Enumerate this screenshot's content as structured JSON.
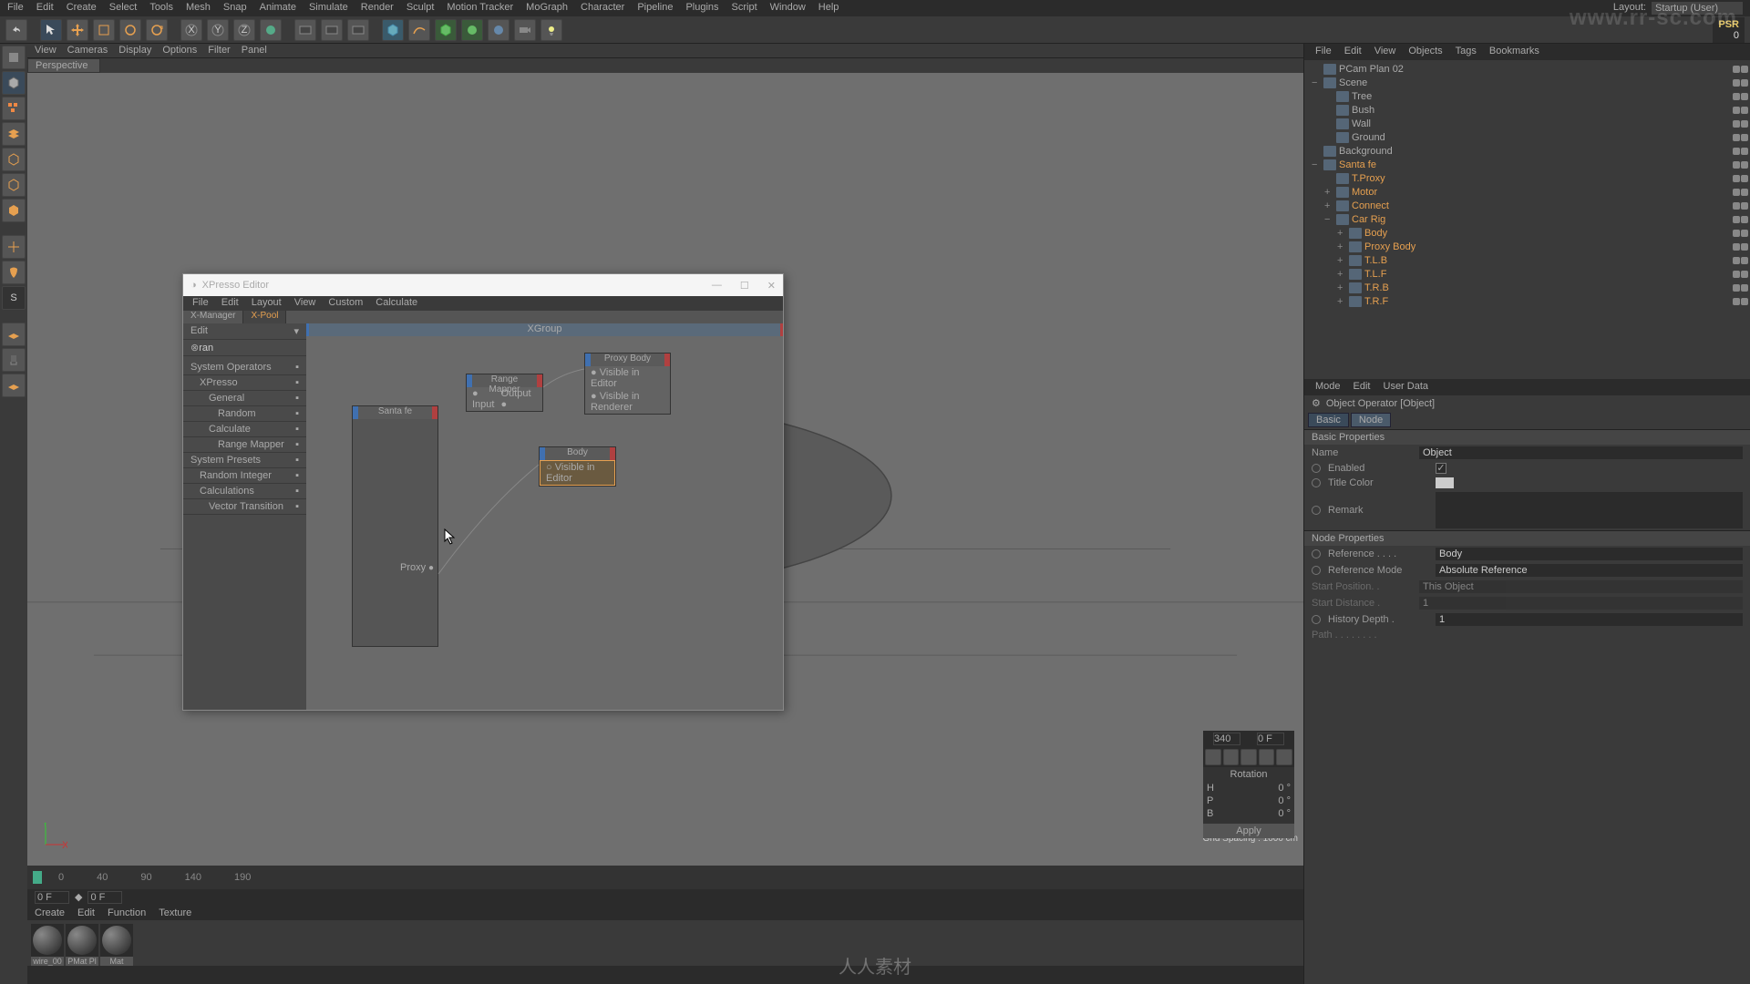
{
  "menubar": [
    "File",
    "Edit",
    "Create",
    "Select",
    "Tools",
    "Mesh",
    "Snap",
    "Animate",
    "Simulate",
    "Render",
    "Sculpt",
    "Motion Tracker",
    "MoGraph",
    "Character",
    "Pipeline",
    "Plugins",
    "Script",
    "Window",
    "Help"
  ],
  "layout": {
    "label": "Layout:",
    "value": "Startup (User)"
  },
  "psr": {
    "label": "PSR",
    "value": "0"
  },
  "viewport_menu": [
    "View",
    "Cameras",
    "Display",
    "Options",
    "Filter",
    "Panel"
  ],
  "viewport_tab": "Perspective",
  "grid_spacing": "Grid Spacing : 1000 cm",
  "timeline": {
    "frames": [
      "0",
      "40",
      "90",
      "140",
      "190"
    ],
    "current": "0 F",
    "alt": "0 F"
  },
  "frame_display": "340",
  "frame_display2": "0 F",
  "material_menu": [
    "Create",
    "Edit",
    "Function",
    "Texture"
  ],
  "materials": [
    "wire_00",
    "PMat Pl",
    "Mat"
  ],
  "object_menu": [
    "File",
    "Edit",
    "View",
    "Objects",
    "Tags",
    "Bookmarks"
  ],
  "tree": [
    {
      "d": 0,
      "exp": "",
      "name": "PCam Plan 02",
      "sel": false
    },
    {
      "d": 0,
      "exp": "−",
      "name": "Scene",
      "sel": false
    },
    {
      "d": 1,
      "exp": "",
      "name": "Tree",
      "sel": false
    },
    {
      "d": 1,
      "exp": "",
      "name": "Bush",
      "sel": false
    },
    {
      "d": 1,
      "exp": "",
      "name": "Wall",
      "sel": false
    },
    {
      "d": 1,
      "exp": "",
      "name": "Ground",
      "sel": false
    },
    {
      "d": 0,
      "exp": "",
      "name": "Background",
      "sel": false
    },
    {
      "d": 0,
      "exp": "−",
      "name": "Santa fe",
      "sel": true
    },
    {
      "d": 1,
      "exp": "",
      "name": "T.Proxy",
      "sel": true
    },
    {
      "d": 1,
      "exp": "+",
      "name": "Motor",
      "sel": true
    },
    {
      "d": 1,
      "exp": "+",
      "name": "Connect",
      "sel": true
    },
    {
      "d": 1,
      "exp": "−",
      "name": "Car Rig",
      "sel": true
    },
    {
      "d": 2,
      "exp": "+",
      "name": "Body",
      "sel": true
    },
    {
      "d": 2,
      "exp": "+",
      "name": "Proxy Body",
      "sel": true
    },
    {
      "d": 2,
      "exp": "+",
      "name": "T.L.B",
      "sel": true
    },
    {
      "d": 2,
      "exp": "+",
      "name": "T.L.F",
      "sel": true
    },
    {
      "d": 2,
      "exp": "+",
      "name": "T.R.B",
      "sel": true
    },
    {
      "d": 2,
      "exp": "+",
      "name": "T.R.F",
      "sel": true
    }
  ],
  "attr_menu": [
    "Mode",
    "Edit",
    "User Data"
  ],
  "attr_title": "Object Operator [Object]",
  "attr_tabs": [
    "Basic",
    "Node"
  ],
  "basic_section": "Basic Properties",
  "basic": {
    "name_lbl": "Name",
    "name_val": "Object",
    "enabled_lbl": "Enabled",
    "enabled_chk": "✓",
    "titlecolor_lbl": "Title Color",
    "remark_lbl": "Remark"
  },
  "node_section": "Node Properties",
  "node": {
    "reference_lbl": "Reference . . . .",
    "reference_val": "Body",
    "refmode_lbl": "Reference Mode",
    "refmode_val": "Absolute Reference",
    "startpos_lbl": "Start Position. .",
    "startpos_val": "This Object",
    "startdist_lbl": "Start Distance .",
    "startdist_val": "1",
    "history_lbl": "History Depth .",
    "history_val": "1",
    "path_lbl": "Path . . . . . . . ."
  },
  "dialog": {
    "title": "XPresso Editor",
    "menu": [
      "File",
      "Edit",
      "Layout",
      "View",
      "Custom",
      "Calculate"
    ],
    "tabs": [
      "X-Manager",
      "X-Pool"
    ],
    "xpool_edit": "Edit",
    "xpool_search": "ran",
    "xpool_tree": [
      {
        "d": 0,
        "name": "System Operators",
        "hi": false
      },
      {
        "d": 1,
        "name": "XPresso",
        "hi": false
      },
      {
        "d": 2,
        "name": "General",
        "hi": false
      },
      {
        "d": 3,
        "name": "Random",
        "hi": false
      },
      {
        "d": 2,
        "name": "Calculate",
        "hi": false
      },
      {
        "d": 3,
        "name": "Range Mapper",
        "hi": true
      },
      {
        "d": 0,
        "name": "System Presets",
        "hi": false
      },
      {
        "d": 1,
        "name": "Random Integer",
        "hi": false
      },
      {
        "d": 1,
        "name": "Calculations",
        "hi": false
      },
      {
        "d": 2,
        "name": "Vector Transition",
        "hi": false
      }
    ],
    "xgroup": "XGroup",
    "nodes": {
      "santafe": {
        "title": "Santa fe",
        "port": "Proxy"
      },
      "range": {
        "title": "Range Mapper",
        "in": "Input",
        "out": "Output"
      },
      "proxybody": {
        "title": "Proxy Body",
        "p1": "Visible in Editor",
        "p2": "Visible in Renderer"
      },
      "body": {
        "title": "Body",
        "p1": "Visible in Editor"
      }
    }
  },
  "coord": {
    "title": "Rotation",
    "rows": [
      [
        "H",
        "0 °"
      ],
      [
        "P",
        "0 °"
      ],
      [
        "B",
        "0 °"
      ]
    ],
    "apply": "Apply"
  },
  "watermark": "www.rr-sc.com",
  "watermark2": "人人素材"
}
